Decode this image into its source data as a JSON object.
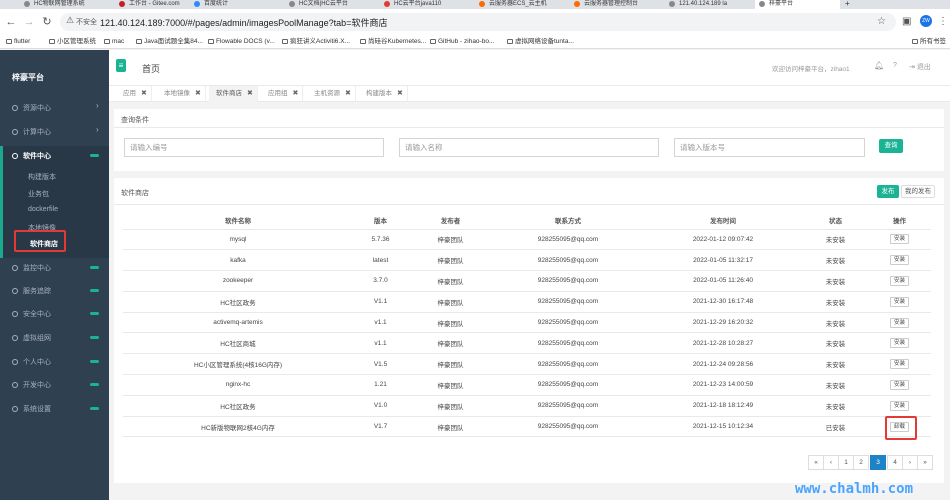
{
  "browser": {
    "tabs": [
      {
        "label": "HC物联网管理系统"
      },
      {
        "label": "工作台 - Gitee.com"
      },
      {
        "label": "百度统计"
      },
      {
        "label": "HC文档|HC云平台"
      },
      {
        "label": "HC云平台java110"
      },
      {
        "label": "云服务器ECS_云主机"
      },
      {
        "label": "云服务器管理控制台"
      },
      {
        "label": "121.40.124.189 la"
      },
      {
        "label": "梓豪平台"
      }
    ],
    "insecure_label": "不安全",
    "url": "121.40.124.189:7000/#/pages/admin/imagesPoolManage?tab=软件商店",
    "profile_initials": "ZW",
    "bookmarks": [
      "flutter",
      "小区管理系统",
      "mac",
      "Java面试题全集84...",
      "Flowable DOCS (v...",
      "疯狂讲义Activiti6.X...",
      "尚硅谷Kubernetes...",
      "GitHub - zihao-bo...",
      "虚拟网络设备tunta..."
    ],
    "all_bookmarks": "所有书签"
  },
  "sidebar": {
    "logo": "梓豪平台",
    "menus": [
      {
        "label": "资源中心"
      },
      {
        "label": "计算中心"
      },
      {
        "label": "软件中心"
      },
      {
        "label": "监控中心"
      },
      {
        "label": "服务追踪"
      },
      {
        "label": "安全中心"
      },
      {
        "label": "虚拟组网"
      },
      {
        "label": "个人中心"
      },
      {
        "label": "开发中心"
      },
      {
        "label": "系统设置"
      }
    ],
    "submenu": [
      {
        "label": "构建版本"
      },
      {
        "label": "业务包"
      },
      {
        "label": "dockerfile"
      },
      {
        "label": "本地镜像"
      },
      {
        "label": "软件商店"
      }
    ]
  },
  "header": {
    "title": "首页",
    "welcome": "欢迎访问梓豪平台，zihao1",
    "logout": "退出"
  },
  "page_tabs": [
    {
      "label": "应用"
    },
    {
      "label": "本地镜像"
    },
    {
      "label": "软件商店"
    },
    {
      "label": "应用组"
    },
    {
      "label": "主机资源"
    },
    {
      "label": "构建版本"
    }
  ],
  "query": {
    "title": "查询条件",
    "placeholders": [
      "请输入编号",
      "请输入名称",
      "请输入版本号"
    ],
    "button": "查询"
  },
  "store": {
    "title": "软件商店",
    "publish": "发布",
    "my_publish": "我的发布",
    "columns": [
      "软件名称",
      "版本",
      "发布者",
      "联系方式",
      "发布时间",
      "状态",
      "操作"
    ],
    "rows": [
      {
        "name": "mysql",
        "version": "5.7.36",
        "publisher": "梓豪团队",
        "contact": "928255095@qq.com",
        "time": "2022-01-12 09:07:42",
        "status": "未安装",
        "action": "安装"
      },
      {
        "name": "kafka",
        "version": "latest",
        "publisher": "梓豪团队",
        "contact": "928255095@qq.com",
        "time": "2022-01-05 11:32:17",
        "status": "未安装",
        "action": "安装"
      },
      {
        "name": "zookeeper",
        "version": "3.7.0",
        "publisher": "梓豪团队",
        "contact": "928255095@qq.com",
        "time": "2022-01-05 11:26:40",
        "status": "未安装",
        "action": "安装"
      },
      {
        "name": "HC社区政务",
        "version": "V1.1",
        "publisher": "梓豪团队",
        "contact": "928255095@qq.com",
        "time": "2021-12-30 16:17:48",
        "status": "未安装",
        "action": "安装"
      },
      {
        "name": "activemq-artemis",
        "version": "v1.1",
        "publisher": "梓豪团队",
        "contact": "928255095@qq.com",
        "time": "2021-12-29 16:20:32",
        "status": "未安装",
        "action": "安装"
      },
      {
        "name": "HC社区商城",
        "version": "v1.1",
        "publisher": "梓豪团队",
        "contact": "928255095@qq.com",
        "time": "2021-12-28 10:28:27",
        "status": "未安装",
        "action": "安装"
      },
      {
        "name": "HC小区管理系统(4核16G内存)",
        "version": "V1.5",
        "publisher": "梓豪团队",
        "contact": "928255095@qq.com",
        "time": "2021-12-24 09:28:56",
        "status": "未安装",
        "action": "安装"
      },
      {
        "name": "nginx-hc",
        "version": "1.21",
        "publisher": "梓豪团队",
        "contact": "928255095@qq.com",
        "time": "2021-12-23 14:00:59",
        "status": "未安装",
        "action": "安装"
      },
      {
        "name": "HC社区政务",
        "version": "V1.0",
        "publisher": "梓豪团队",
        "contact": "928255095@qq.com",
        "time": "2021-12-18 18:12:49",
        "status": "未安装",
        "action": "安装"
      },
      {
        "name": "HC新版物联网2核4G内存",
        "version": "V1.7",
        "publisher": "梓豪团队",
        "contact": "928255095@qq.com",
        "time": "2021-12-15 10:12:34",
        "status": "已安装",
        "action": "卸载"
      }
    ]
  },
  "pager": {
    "first": "«",
    "prev": "‹",
    "pages": [
      "1",
      "2",
      "3",
      "4"
    ],
    "current": "3",
    "next": "›",
    "last": "»"
  },
  "watermark": "www.chalmh.com"
}
